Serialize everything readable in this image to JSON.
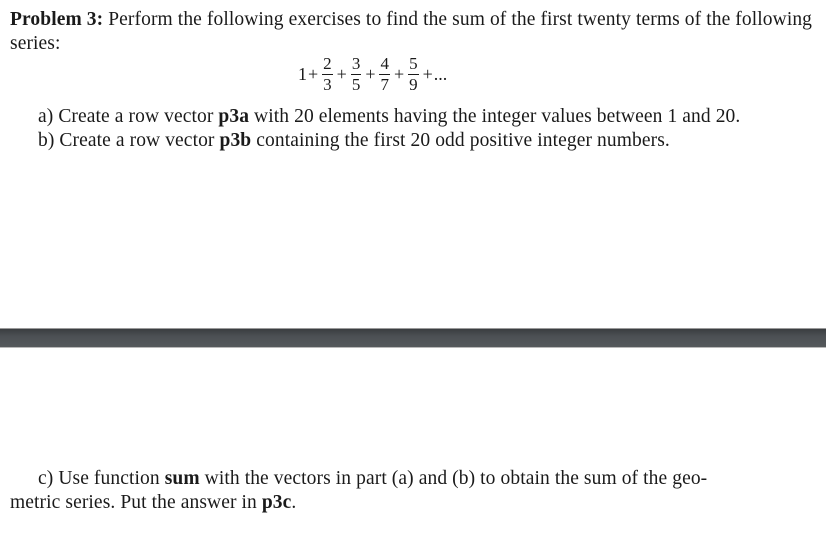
{
  "problem": {
    "label": "Problem 3:",
    "intro": " Perform the following exercises to find the sum of the first twenty terms of the following series:"
  },
  "series": {
    "first_term": "1",
    "fractions": [
      {
        "num": "2",
        "den": "3"
      },
      {
        "num": "3",
        "den": "5"
      },
      {
        "num": "4",
        "den": "7"
      },
      {
        "num": "5",
        "den": "9"
      }
    ],
    "plus": "+",
    "ellipsis": "..."
  },
  "part_a": {
    "prefix": "a) Create a row vector ",
    "var": "p3a",
    "suffix": " with 20 elements having the integer values between 1 and 20."
  },
  "part_b": {
    "prefix": "b) Create a row vector ",
    "var": "p3b",
    "suffix": " containing the first 20 odd positive integer numbers."
  },
  "part_c": {
    "prefix": "c) Use function ",
    "func": "sum",
    "middle": " with the vectors in part (a) and (b) to obtain the sum of the geo-",
    "line2": "metric series. Put the answer in ",
    "var": "p3c",
    "end": "."
  }
}
